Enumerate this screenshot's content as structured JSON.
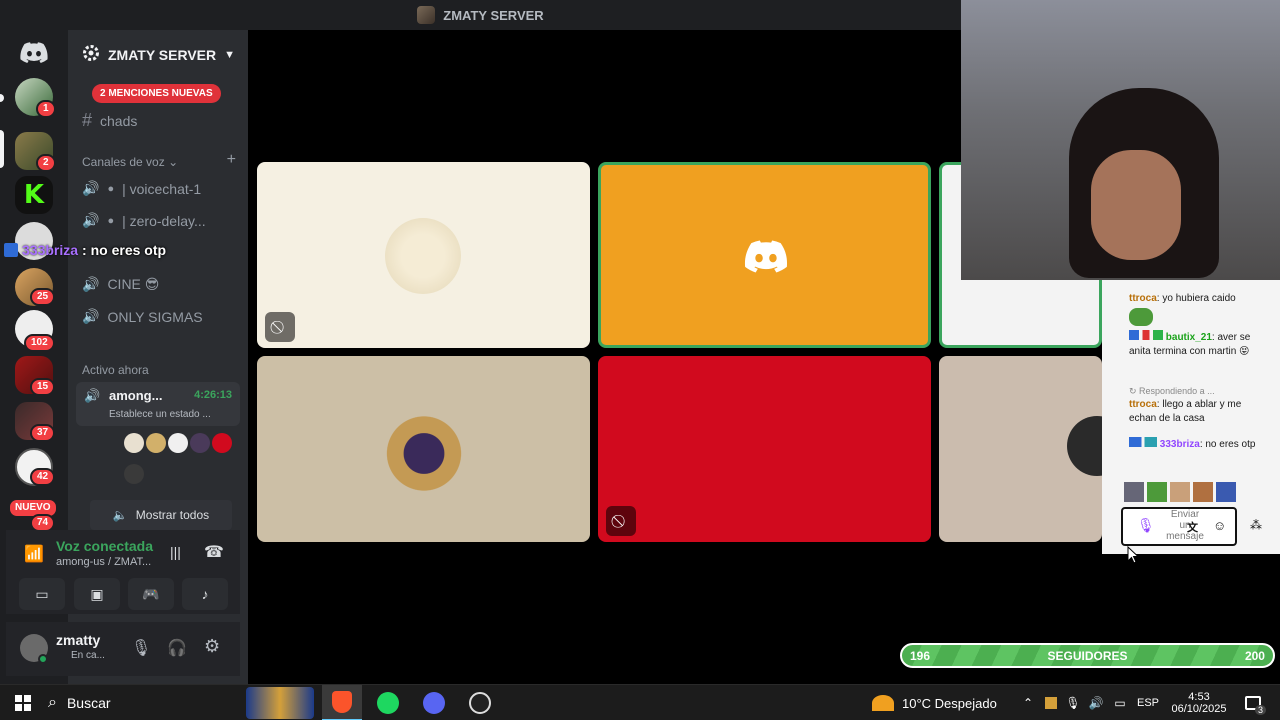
{
  "titlebar": {
    "title": "ZMATY SERVER"
  },
  "rail": {
    "badges": [
      "1",
      "2",
      "25",
      "102",
      "15",
      "37",
      "42",
      "74"
    ],
    "new_label": "NUEVO"
  },
  "sidebar": {
    "server_name": "ZMATY SERVER",
    "mentions": "2 MENCIONES NUEVAS",
    "text_channel": "chads",
    "voice_category": "Canales de voz",
    "voice_channels": [
      "| voicechat-1",
      "| zero-delay...",
      "CINE 😎",
      "ONLY SIGMAS"
    ],
    "overlay_user": "333briza",
    "overlay_msg": ": no eres otp",
    "active_title": "Activo ahora",
    "activity": {
      "name": "among...",
      "time": "4:26:13",
      "status": "Establece un estado ..."
    },
    "show_all": "Mostrar todos",
    "voice": {
      "status": "Voz conectada",
      "channel": "among-us / ZMAT..."
    },
    "user": {
      "name": "zmatty",
      "status": "En ca..."
    }
  },
  "chat": {
    "messages": [
      {
        "user": "ttroca",
        "text": ": yo hubiera caido",
        "color": "#b8700a"
      },
      {
        "user": "bautix_21",
        "text": ": aver se anita termina con martin 😝",
        "color": "#1ba31b"
      },
      {
        "reply": "Respondiendo a ..."
      },
      {
        "user": "ttroca",
        "text": ": llego a ablar y me echan de la casa",
        "color": "#b8700a"
      },
      {
        "user": "333briza",
        "text": ": no eres otp",
        "color": "#9146ff"
      }
    ],
    "input_placeholder": "Enviar un mensaje"
  },
  "followers": {
    "current": "196",
    "label": "SEGUIDORES",
    "goal": "200",
    "progress": 0.98
  },
  "taskbar": {
    "search": "Buscar",
    "weather": "10°C  Despejado",
    "lang": "ESP",
    "time": "4:53",
    "date": "06/10/2025",
    "notif": "3"
  },
  "colors": {
    "discord_orange": "#f0a020",
    "tile_red": "#d10a1e",
    "speaking_green": "#3ba55d"
  }
}
